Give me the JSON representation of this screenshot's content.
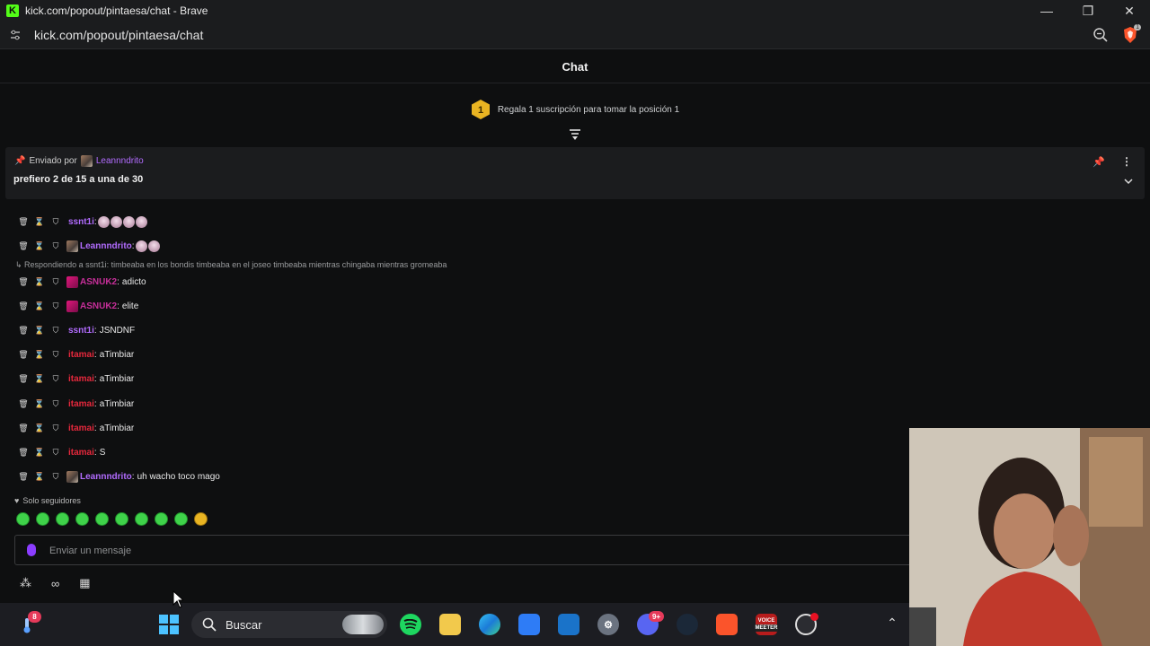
{
  "window": {
    "title": "kick.com/popout/pintaesa/chat - Brave",
    "minimize": "—",
    "restore": "❐",
    "close": "✕"
  },
  "address_bar": {
    "url": "kick.com/popout/pintaesa/chat",
    "brave_badge": "1"
  },
  "chat": {
    "header": "Chat",
    "sub_banner": {
      "rank": "1",
      "text": "Regala 1 suscripción para tomar la posición 1"
    },
    "pinned": {
      "sent_by_label": "Enviado por",
      "username": "Leannndrito",
      "message": "prefiero 2 de 15 a una de 30"
    },
    "messages": [
      {
        "username": "ssnt1i",
        "text": "",
        "color": "#b26cff",
        "avatar": false,
        "emotes": 4
      },
      {
        "username": "Leannndrito",
        "text": "",
        "color": "#b26cff",
        "avatar": true,
        "emotes": 2
      },
      {
        "username": "ASNUK2",
        "text": "adicto",
        "color": "#c82f9a",
        "avatar": true,
        "emotes": 0
      },
      {
        "username": "ASNUK2",
        "text": "elite",
        "color": "#c82f9a",
        "avatar": true,
        "emotes": 0
      },
      {
        "username": "ssnt1i",
        "text": "JSNDNF",
        "color": "#b26cff",
        "avatar": false,
        "emotes": 0
      },
      {
        "username": "itamai",
        "text": "aTimbiar",
        "color": "#e5283c",
        "avatar": false,
        "emotes": 0
      },
      {
        "username": "itamai",
        "text": "aTimbiar",
        "color": "#e5283c",
        "avatar": false,
        "emotes": 0
      },
      {
        "username": "itamai",
        "text": "aTimbiar",
        "color": "#e5283c",
        "avatar": false,
        "emotes": 0
      },
      {
        "username": "itamai",
        "text": "aTimbiar",
        "color": "#e5283c",
        "avatar": false,
        "emotes": 0
      },
      {
        "username": "itamai",
        "text": "S",
        "color": "#e5283c",
        "avatar": false,
        "emotes": 0
      },
      {
        "username": "Leannndrito",
        "text": "uh wacho toco mago",
        "color": "#b26cff",
        "avatar": true,
        "emotes": 0
      }
    ],
    "reply_context": "Respondiendo a ssnt1i: timbeaba en los bondis timbeaba en el joseo timbeaba mientras chingaba mientras gromeaba",
    "followers_only": "Solo seguidores",
    "input_placeholder": "Enviar un mensaje"
  },
  "taskbar": {
    "search_label": "Buscar",
    "weather_badge": "8",
    "discord_badge": "9+",
    "voicemeeter_top": "VOICE",
    "voicemeeter_bottom": "MEETER",
    "tray_chevron": "⌃"
  },
  "colors": {
    "accent_green": "#53fc18",
    "username_purple": "#b26cff",
    "username_red": "#e5283c",
    "background": "#0e0f10"
  }
}
